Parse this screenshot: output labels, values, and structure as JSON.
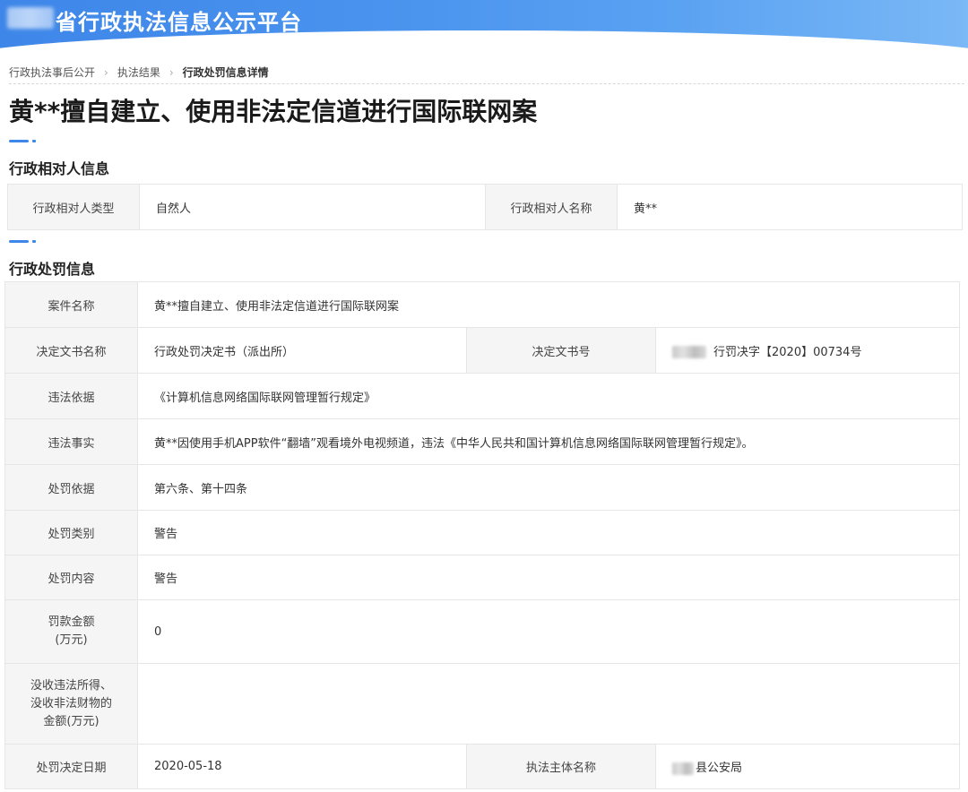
{
  "header": {
    "site_title": "省行政执法信息公示平台"
  },
  "breadcrumb": [
    "行政执法事后公开",
    "执法结果",
    "行政处罚信息详情"
  ],
  "page_title": "黄**擅自建立、使用非法定信道进行国际联网案",
  "party_section": {
    "title": "行政相对人信息",
    "type_label": "行政相对人类型",
    "type_value": "自然人",
    "name_label": "行政相对人名称",
    "name_value": "黄**"
  },
  "penalty_section": {
    "title": "行政处罚信息",
    "rows": {
      "case_name_label": "案件名称",
      "case_name_value": "黄**擅自建立、使用非法定信道进行国际联网案",
      "doc_name_label": "决定文书名称",
      "doc_name_value": "行政处罚决定书（派出所）",
      "doc_no_label": "决定文书号",
      "doc_no_value": "行罚决字【2020】00734号",
      "basis_label": "违法依据",
      "basis_value": "《计算机信息网络国际联网管理暂行规定》",
      "facts_label": "违法事实",
      "facts_value": "黄**因使用手机APP软件“翻墙”观看境外电视频道，违法《中华人民共和国计算机信息网络国际联网管理暂行规定》。",
      "penalty_basis_label": "处罚依据",
      "penalty_basis_value": "第六条、第十四条",
      "penalty_type_label": "处罚类别",
      "penalty_type_value": "警告",
      "penalty_content_label": "处罚内容",
      "penalty_content_value": "警告",
      "fine_label_line1": "罚款金额",
      "fine_label_line2": "(万元)",
      "fine_value": "0",
      "confiscation_label_line1": "没收违法所得、",
      "confiscation_label_line2": "没收非法财物的",
      "confiscation_label_line3": "金额(万元)",
      "confiscation_value": "",
      "date_label": "处罚决定日期",
      "date_value": "2020-05-18",
      "authority_label": "执法主体名称",
      "authority_value": "县公安局"
    }
  }
}
